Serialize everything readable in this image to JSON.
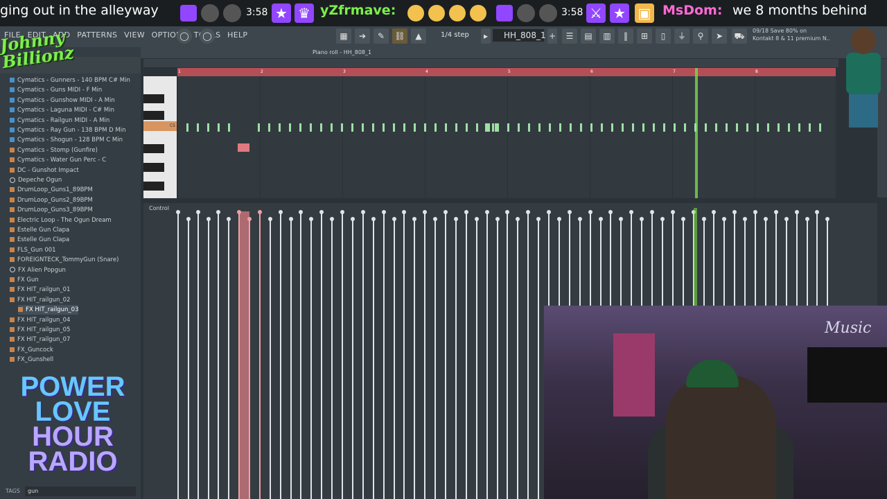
{
  "ticker": {
    "msg1": "ging out in the alleyway",
    "time1": "3:58",
    "user2": "yZfrmave:",
    "time2": "3:58",
    "user3": "MsDom:",
    "msg3": "we 8 months behind"
  },
  "menu": {
    "file": "FILE",
    "edit": "EDIT",
    "add": "ADD",
    "patterns": "PATTERNS",
    "view": "VIEW",
    "options": "OPTIONS",
    "tools": "TOOLS",
    "help": "HELP"
  },
  "toolbar": {
    "step": "1/4 step",
    "pattern": "HH_808_1",
    "promo_line1": "09/18  Save 80% on",
    "promo_line2": "Kontakt 8 & 11 premium N.."
  },
  "piano_roll": {
    "title": "Piano roll - HH_808_1",
    "key_label": "C5",
    "control_label": "Control",
    "bar_numbers": [
      "1",
      "2",
      "3",
      "4",
      "5",
      "6",
      "7",
      "8"
    ]
  },
  "browser": {
    "items": [
      {
        "label": "Cymatics - Gunners - 140 BPM C# Min",
        "type": "midi"
      },
      {
        "label": "Cymatics - Guns MIDI - F Min",
        "type": "midi"
      },
      {
        "label": "Cymatics - Gunshow MIDI - A Min",
        "type": "midi"
      },
      {
        "label": "Cymatics - Laguna MIDI - C# Min",
        "type": "midi"
      },
      {
        "label": "Cymatics - Railgun MIDI - A Min",
        "type": "midi"
      },
      {
        "label": "Cymatics - Ray Gun - 138 BPM D Min",
        "type": "midi"
      },
      {
        "label": "Cymatics - Shogun - 128 BPM C Min",
        "type": "midi"
      },
      {
        "label": "Cymatics - Stomp (Gunfire)",
        "type": "wav"
      },
      {
        "label": "Cymatics - Water Gun Perc - C",
        "type": "wav"
      },
      {
        "label": "DC - Gunshot Impact",
        "type": "wav"
      },
      {
        "label": "Depeche Ogun",
        "type": "plug"
      },
      {
        "label": "DrumLoop_Guns1_89BPM",
        "type": "wav"
      },
      {
        "label": "DrumLoop_Guns2_89BPM",
        "type": "wav"
      },
      {
        "label": "DrumLoop_Guns3_89BPM",
        "type": "wav"
      },
      {
        "label": "Electric Loop - The Ogun Dream",
        "type": "wav"
      },
      {
        "label": "Estelle Gun Clapa",
        "type": "wav"
      },
      {
        "label": "Estelle Gun Clapa",
        "type": "wav"
      },
      {
        "label": "FLS_Gun 001",
        "type": "wav"
      },
      {
        "label": "FOREIGNTECK_TommyGun (Snare)",
        "type": "wav"
      },
      {
        "label": "FX Alien Popgun",
        "type": "plug"
      },
      {
        "label": "FX Gun",
        "type": "wav"
      },
      {
        "label": "FX HIT_railgun_01",
        "type": "wav"
      },
      {
        "label": "FX HIT_railgun_02",
        "type": "wav"
      },
      {
        "label": "FX HIT_railgun_03",
        "type": "wav",
        "selected": true
      },
      {
        "label": "FX HIT_railgun_04",
        "type": "wav"
      },
      {
        "label": "FX HIT_railgun_05",
        "type": "wav"
      },
      {
        "label": "FX HIT_railgun_07",
        "type": "wav"
      },
      {
        "label": "FX_Guncock",
        "type": "wav"
      },
      {
        "label": "FX_Gunshell",
        "type": "wav"
      }
    ],
    "tags_label": "TAGS",
    "search_value": "gun"
  },
  "overlay": {
    "logo_top": "Johnny Billionz",
    "radio_line1": "POWER",
    "radio_line2": "LOVE",
    "radio_line3": "HOUR",
    "radio_line4": "RADIO"
  },
  "webcam": {
    "neon_sign": "Music"
  }
}
